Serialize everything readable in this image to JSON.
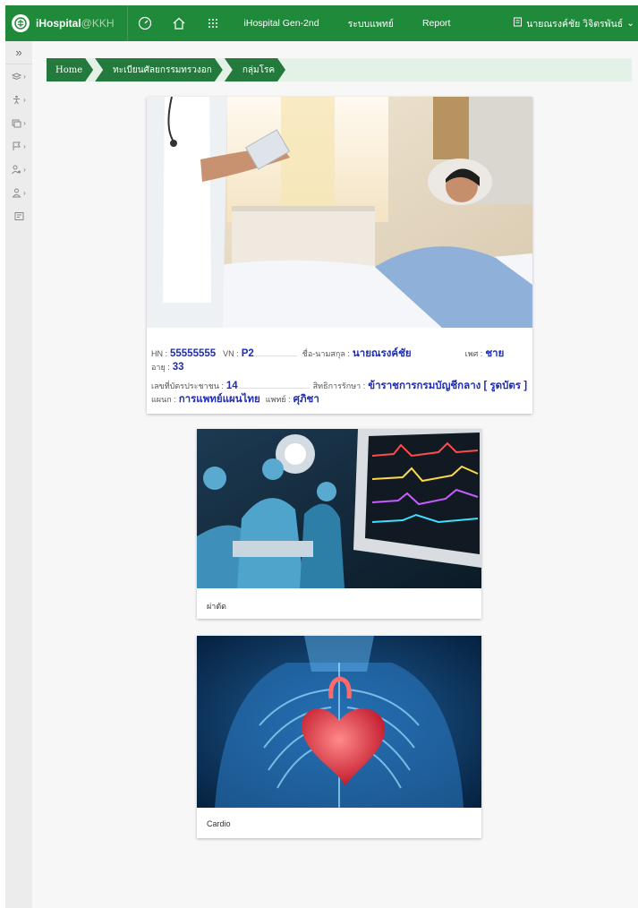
{
  "header": {
    "brand": "iHospital",
    "brand_suffix": "@KKH",
    "nav": [
      "iHospital Gen-2nd",
      "ระบบแพทย์",
      "Report"
    ],
    "user_name": "นายณรงค์ชัย วิจิตรพันธ์"
  },
  "breadcrumb": [
    "Home",
    "ทะเบียนศัลยกรรมทรวงอก",
    "กลุ่มโรค"
  ],
  "patient": {
    "hn_label": "HN :",
    "hn": "55555555",
    "vn_label": "VN :",
    "vn": "P2",
    "name_label": "ชื่อ-นามสกุล :",
    "name": "นายณรงค์ชัย",
    "sex_label": "เพศ :",
    "sex": "ชาย",
    "age_label": "อายุ :",
    "age": "33",
    "id_label": "เลขที่บัตรประชาชน :",
    "id": "14",
    "rights_label": "สิทธิการรักษา :",
    "rights": "ข้าราชการกรมบัญชีกลาง [ รูดบัตร ]",
    "dept_label": "แผนก :",
    "dept": "การแพทย์แผนไทย",
    "doctor_label": "แพทย์ :",
    "doctor": "ศุภิชา"
  },
  "menu_cards": [
    {
      "label": "ผ่าตัด"
    },
    {
      "label": "Cardio"
    }
  ],
  "icons": {
    "logo": "hospital-logo-icon",
    "dashboard": "speedometer-icon",
    "home": "home-icon",
    "apps": "grid-dots-icon",
    "user": "id-card-icon"
  },
  "colors": {
    "topbar": "#1f8a3a",
    "breadcrumb": "#237a3c",
    "value_text": "#1f2db3"
  }
}
